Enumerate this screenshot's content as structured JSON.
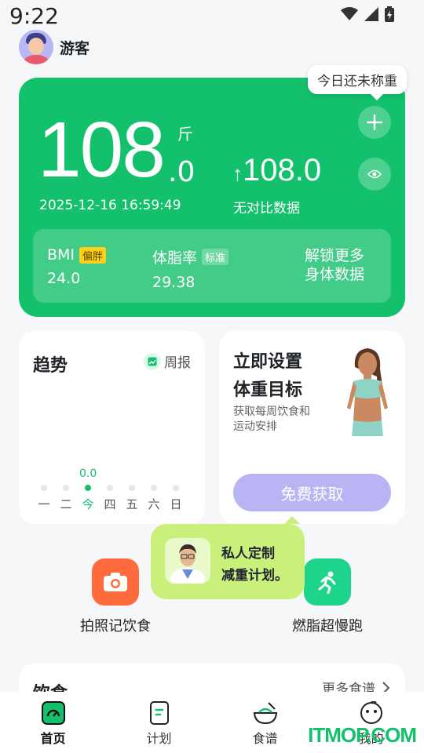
{
  "status": {
    "time": "9:22"
  },
  "user": {
    "name": "游客"
  },
  "weight": {
    "tip": "今日还未称重",
    "integer": "108",
    "decimal": ".0",
    "unit": "斤",
    "datetime": "2025-12-16 16:59:49",
    "compare_value": "108.0",
    "compare_label": "无对比数据",
    "bmi_label": "BMI",
    "bmi_tag": "偏胖",
    "bmi_value": "24.0",
    "bodyfat_label": "体脂率",
    "bodyfat_tag": "标准",
    "bodyfat_value": "29.38",
    "unlock_line1": "解锁更多",
    "unlock_line2": "身体数据"
  },
  "trend": {
    "title": "趋势",
    "weekly": "周报",
    "today_value": "0.0",
    "days": [
      "一",
      "二",
      "今",
      "四",
      "五",
      "六",
      "日"
    ]
  },
  "goal": {
    "line1": "立即设置",
    "line2": "体重目标",
    "desc1": "获取每周饮食和",
    "desc2": "运动安排",
    "button": "免费获取"
  },
  "popup": {
    "line1": "私人定制",
    "line2": "减重计划。"
  },
  "quick": [
    {
      "label": "拍照记饮食",
      "color": "#ff6b3d"
    },
    {
      "label": "燃脂超慢跑",
      "color": "#1ed48a"
    }
  ],
  "diet": {
    "title": "饮食",
    "more": "更多食谱"
  },
  "tabs": [
    {
      "label": "首页"
    },
    {
      "label": "计划"
    },
    {
      "label": "食谱"
    },
    {
      "label": "我的"
    }
  ],
  "watermark": "ITMOP.COM",
  "colors": {
    "accent": "#13c06b",
    "goal_button": "#b9b5f4",
    "popup": "#c8f07a"
  }
}
